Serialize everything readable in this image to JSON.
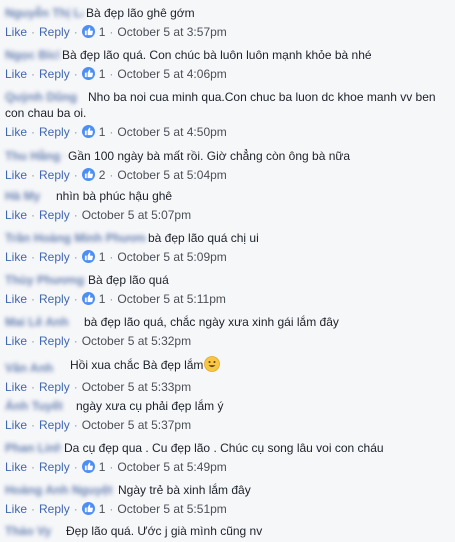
{
  "labels": {
    "like": "Like",
    "reply": "Reply",
    "sep": "·"
  },
  "comments": [
    {
      "name": "Nguyễn Thị Lan",
      "text": "Bà đẹp lão ghê gớm",
      "likes": "1",
      "time": "October 5 at 3:57pm"
    },
    {
      "name": "Ngọc Bích",
      "text": "Bà đẹp lão quá. Con chúc bà luôn luôn mạnh khỏe bà nhé",
      "likes": "1",
      "time": "October 5 at 4:06pm"
    },
    {
      "name": "Quỳnh Dũng",
      "text": "Nho ba noi cua minh qua.Con chuc ba luon dc khoe manh vv ben con chau ba oi.",
      "likes": "1",
      "time": "October 5 at 4:50pm"
    },
    {
      "name": "Thu Hằng ^",
      "text": "Gần 100 ngày bà mất rồi. Giờ chẳng còn ông bà nữa",
      "likes": "2",
      "time": "October 5 at 5:04pm"
    },
    {
      "name": "Hà My",
      "text": "nhìn bà phúc hậu ghê",
      "likes": "",
      "time": "October 5 at 5:07pm"
    },
    {
      "name": "Trần Hoàng Minh Phương",
      "text": "bà đẹp lão quá chị ui",
      "likes": "1",
      "time": "October 5 at 5:09pm"
    },
    {
      "name": "Thùy Phương",
      "text": "Bà đẹp lão quá",
      "likes": "1",
      "time": "October 5 at 5:11pm"
    },
    {
      "name": "Mai Lê Anh",
      "text": "bà đẹp lão quá, chắc ngày xưa xinh gái lắm đây",
      "likes": "",
      "time": "October 5 at 5:32pm"
    },
    {
      "name": "Vân Anh",
      "text": "Hồi xua chắc Bà đẹp lắm",
      "likes": "",
      "time": "October 5 at 5:33pm"
    },
    {
      "name": "Ánh Tuyết",
      "text": "ngày xưa cụ phải đẹp lắm ý",
      "likes": "",
      "time": "October 5 at 5:37pm"
    },
    {
      "name": "Phan Linh",
      "text": "Da cụ đẹp qua . Cu đẹp lão . Chúc cụ song lâu voi con cháu",
      "likes": "1",
      "time": "October 5 at 5:49pm"
    },
    {
      "name": "Hoàng Anh Nguyệt",
      "text": "Ngày trẻ bà xinh lắm đây",
      "likes": "1",
      "time": "October 5 at 5:51pm"
    },
    {
      "name": "Thảo Vy",
      "text": "Đẹp lão quá. Ước j già mình cũng nv",
      "likes": "",
      "time": ""
    }
  ]
}
